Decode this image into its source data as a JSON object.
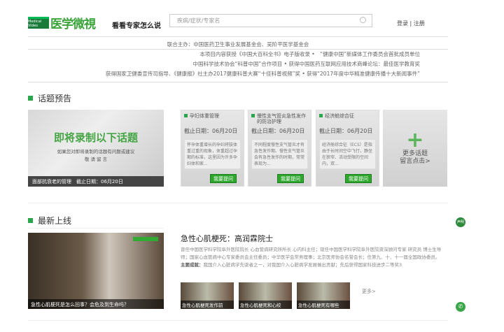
{
  "header": {
    "logo_small": "Medical Video",
    "logo_text": "医学微視",
    "slogan": "看看专家怎么说",
    "search_placeholder": "疾病/症状/专家名",
    "login": "登录 | 注册"
  },
  "sponsor": "联合主办：中国医药卫生事业发展基金会、吴阶平医学基金会",
  "info_lines": [
    "本项目内容获授《中国大百科全书》电子版收录 •　“健康中国”新媒体工作委员会首批成员单位",
    "中国科学技术协会“科普中国”合作项目 • 获得中国医药互联网应用技术商峰论坛：最佳医学教育奖",
    "获得国家卫健委宣传司指导、《健康报》社主办2017健康科普大赛“十佳科普视频”奖 • 获得“2017年度中华精准健康传播十大新闻事件”"
  ],
  "topics": {
    "title": "话题预告",
    "banner_title": "即将录制以下话题",
    "banner_sub": "如果您对即将录制的话题有问题或建议",
    "banner_sub2": "敬 请 留 言",
    "banner_caption": "面部抗衰老的管理　截止日期：06月20日",
    "cards": [
      {
        "title": "孕妇体重管理",
        "date": "截止日期：06月20日",
        "body": "怀孕体重增长的孕妇将肢体重过重的现象，体重超过孕期的标准，这里因为许多孕妇体和家...",
        "button": "我要提问"
      },
      {
        "title": "慢性支气管炎急性发作的防治护理",
        "date": "截止日期：06月20日",
        "body": "不同程度慢性支气管炎才有急性发作期、慢性支气管炎会有急性发作的时期，常常表现为...",
        "button": "我要提问"
      },
      {
        "title": "经济舱综合征",
        "date": "截止日期：06月20日",
        "body": "经济舱综合征（ECS）是指由于长时间空中飞行，静坐在狭窄、活动受限的空间内，双...",
        "button": "我要提问"
      }
    ],
    "more": "更多话题",
    "more2": "留言点击>"
  },
  "latest": {
    "title": "最新上线",
    "video_caption": "急性心肌梗死是怎么回事？会危及到生命吗？",
    "headline": "急性心肌梗死：高润霖院士",
    "desc": "曾任中国医学科学院阜外医院院长 心血管病研究所所长 心内科主任；现任中国医学科学院阜外医院资深顾问专家 研究员 博士生导师；国家心血管病中心专家委员会主任委员；中华医学会常务理事；北京医师协会名誉会长；任第九、十、十一届全国政协委员。",
    "ach_label": "主要成就：",
    "ach": "我国介入心脏病学先驱者之一，对我国介入心脏病学发展做出贡献；先后获得国家科技进步二等奖3",
    "thumbs": [
      "急性心肌梗死发作前",
      "急性心肌梗死和心绞",
      "急性心肌梗死有哪些"
    ],
    "more": "更多>"
  },
  "side": {
    "voice": "声明"
  }
}
